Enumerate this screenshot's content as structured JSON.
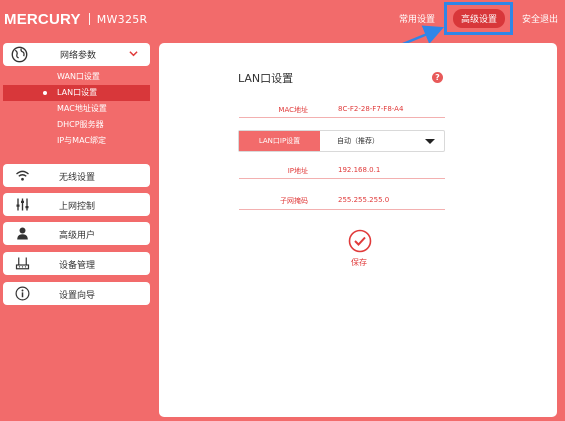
{
  "brand": {
    "logo": "MERCURY",
    "model": "MW325R"
  },
  "topnav": {
    "common": "常用设置",
    "advanced": "高级设置",
    "logout": "安全退出"
  },
  "sidebar": {
    "network": {
      "label": "网络参数",
      "items": [
        "WAN口设置",
        "LAN口设置",
        "MAC地址设置",
        "DHCP服务器",
        "IP与MAC绑定"
      ],
      "active": "LAN口设置"
    },
    "items": [
      {
        "label": "无线设置",
        "icon": "wifi-icon"
      },
      {
        "label": "上网控制",
        "icon": "sliders-icon"
      },
      {
        "label": "高级用户",
        "icon": "user-icon"
      },
      {
        "label": "设备管理",
        "icon": "router-icon"
      },
      {
        "label": "设置向导",
        "icon": "info-icon"
      }
    ]
  },
  "panel": {
    "title": "LAN口设置",
    "mac": {
      "label": "MAC地址",
      "value": "8C-F2-28-F7-F8-A4"
    },
    "mode": {
      "label": "LAN口IP设置",
      "value": "自动（推荐）"
    },
    "ip": {
      "label": "IP地址",
      "value": "192.168.0.1"
    },
    "mask": {
      "label": "子网掩码",
      "value": "255.255.255.0"
    },
    "save": "保存"
  },
  "colors": {
    "background": "#f26b6b",
    "accent": "#d8373a",
    "annotation": "#2f86e8"
  }
}
